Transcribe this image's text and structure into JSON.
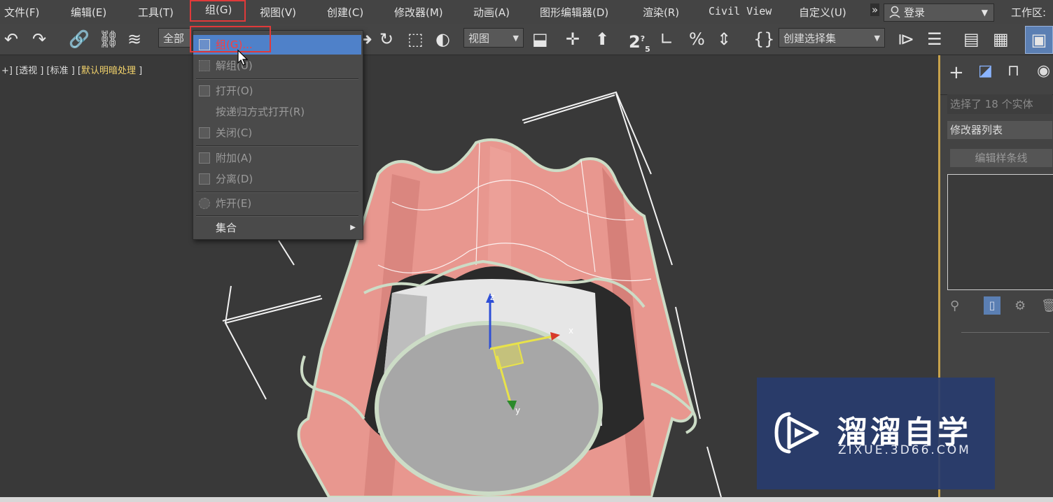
{
  "menubar": {
    "items": [
      "文件(F)",
      "编辑(E)",
      "工具(T)",
      "组(G)",
      "视图(V)",
      "创建(C)",
      "修改器(M)",
      "动画(A)",
      "图形编辑器(D)",
      "渲染(R)",
      "Civil View",
      "自定义(U)"
    ],
    "overflow": "»",
    "login": "登录",
    "workspace": "工作区:"
  },
  "toolbar": {
    "selection_filter": "全部",
    "ref_coord": "视图",
    "named_selection": "创建选择集",
    "snap_label": "2",
    "snap_sub": "5"
  },
  "viewport": {
    "label_prefix": "+] [透视 ] [标准 ] [",
    "label_highlight": "默认明暗处理",
    "label_suffix": " ]",
    "gizmo_x": "x",
    "gizmo_y": "y",
    "gizmo_z": "z"
  },
  "group_menu": {
    "items": [
      {
        "label": "组(G)...",
        "enabled": true,
        "selected": true
      },
      {
        "label": "解组(U)",
        "enabled": false
      },
      {
        "label": "打开(O)",
        "enabled": false
      },
      {
        "label": "按递归方式打开(R)",
        "enabled": false
      },
      {
        "label": "关闭(C)",
        "enabled": false
      },
      {
        "label": "附加(A)",
        "enabled": false
      },
      {
        "label": "分离(D)",
        "enabled": false
      },
      {
        "label": "炸开(E)",
        "enabled": false
      },
      {
        "label": "集合",
        "enabled": true,
        "submenu": true
      }
    ]
  },
  "command_panel": {
    "status": "选择了 18 个实体",
    "modifier_list": "修改器列表",
    "edit_spline_button": "编辑样条线"
  },
  "watermark": {
    "title": "溜溜自学",
    "url": "ZIXUE.3D66.COM"
  },
  "colors": {
    "accent_red": "#e03a3a",
    "menu_highlight": "#4f81c9",
    "object_pink": "#e8978f"
  }
}
